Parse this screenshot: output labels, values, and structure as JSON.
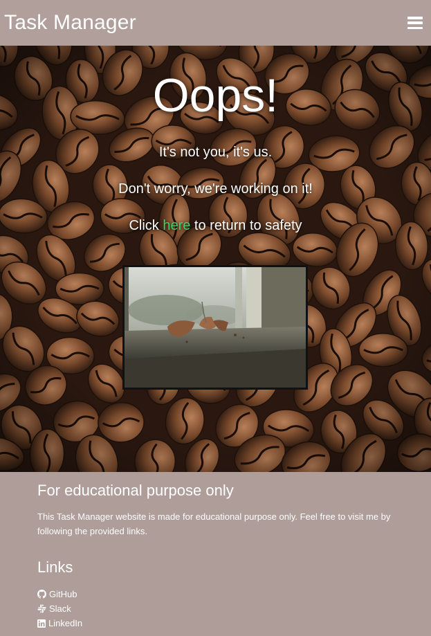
{
  "navbar": {
    "brand": "Task Manager",
    "menu_icon": "hamburger-menu-icon"
  },
  "hero": {
    "heading": "Oops!",
    "line1": "It's not you, it's us.",
    "line2": "Don't worry, we're working on it!",
    "line3_prefix": "Click ",
    "line3_link": "here",
    "line3_suffix": " to return to safety",
    "link_color": "#3fd068",
    "background": "coffee-beans-photo",
    "image": "broken-pot-on-windowsill-photo"
  },
  "footer": {
    "edu_title": "For educational purpose only",
    "edu_text": "This Task Manager website is made for educational purpose only. Feel free to visit me by following the provided links.",
    "links_title": "Links",
    "links": [
      {
        "icon": "github-icon",
        "label": "GitHub"
      },
      {
        "icon": "slack-icon",
        "label": "Slack"
      },
      {
        "icon": "linkedin-icon",
        "label": "LinkedIn"
      }
    ]
  },
  "colors": {
    "navbar": "#b09f9b",
    "footer": "#ae9d99",
    "text": "#ffffff"
  }
}
